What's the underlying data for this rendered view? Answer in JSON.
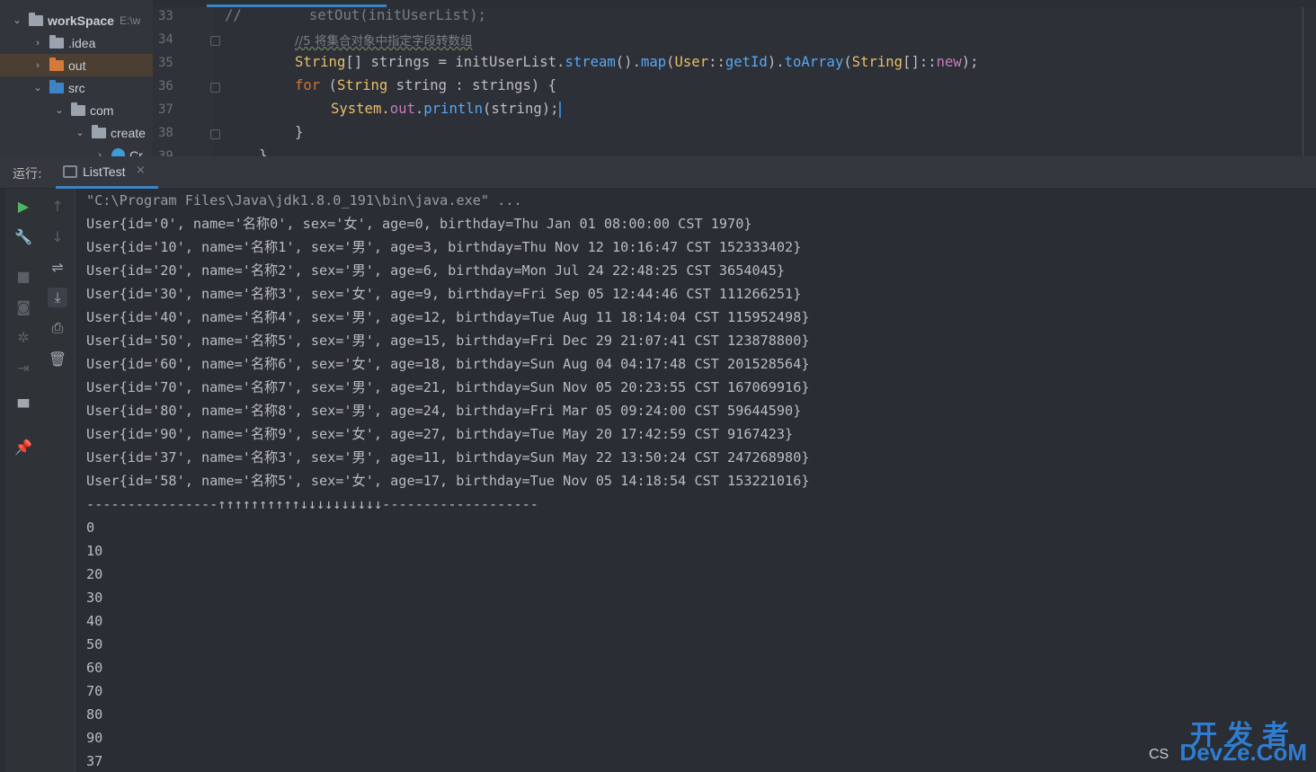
{
  "project_tree": [
    {
      "label": "workSpace",
      "path": "E:\\w",
      "arrow": "v"
    },
    {
      "label": ".idea",
      "arrow": ">"
    },
    {
      "label": "out",
      "arrow": ">"
    },
    {
      "label": "src",
      "arrow": "v"
    },
    {
      "label": "com",
      "arrow": "v"
    },
    {
      "label": "create",
      "arrow": "v"
    },
    {
      "label": "Cr",
      "arrow": ">"
    }
  ],
  "editor": {
    "line_numbers": [
      "33",
      "34",
      "35",
      "36",
      "37",
      "38",
      "39"
    ],
    "line33": {
      "a": "//",
      "b": "setOut(initUserList);"
    },
    "line34": {
      "comment": "//5 将集合对象中指定字段转数组"
    },
    "line35": {
      "t1": "String",
      "t2": "[] strings = initUserList.",
      "m1": "stream",
      "t3": "().",
      "m2": "map",
      "t4": "(",
      "t5": "User",
      "t6": "::",
      "m3": "getId",
      "t7": ").",
      "m4": "toArray",
      "t8": "(",
      "t9": "String",
      "t10": "[]::",
      "kw": "new",
      "t11": ");"
    },
    "line36": {
      "kw": "for",
      "t1": " (",
      "type": "String",
      "t2": " string : strings) {"
    },
    "line37": {
      "t1": "System.",
      "field": "out",
      "t2": ".",
      "method": "println",
      "t3": "(string);"
    },
    "line38": {
      "t1": "}"
    },
    "line39": {
      "t1": "}"
    }
  },
  "run_panel": {
    "label": "运行:",
    "tab_label": "ListTest",
    "tab_close": "×"
  },
  "toolbar_left": [
    {
      "icon": "run-icon",
      "glyph": "▶"
    },
    {
      "icon": "wrench-icon",
      "glyph": "🔧"
    },
    {
      "icon": "stop-icon",
      "glyph": "■"
    },
    {
      "icon": "camera-icon",
      "glyph": "◙"
    },
    {
      "icon": "debug-icon",
      "glyph": "✲"
    },
    {
      "icon": "exit-icon",
      "glyph": "⇥"
    },
    {
      "icon": "layout-icon",
      "glyph": "▀"
    },
    {
      "icon": "pin-icon",
      "glyph": "📌"
    }
  ],
  "toolbar_right": [
    {
      "icon": "up-arrow-icon",
      "glyph": "↑"
    },
    {
      "icon": "down-arrow-icon",
      "glyph": "↓"
    },
    {
      "icon": "soft-wrap-icon",
      "glyph": "⇌"
    },
    {
      "icon": "scroll-to-end-icon",
      "glyph": "⤓"
    },
    {
      "icon": "print-icon",
      "glyph": "⎙"
    },
    {
      "icon": "trash-icon",
      "glyph": "🗑"
    }
  ],
  "console_lines": [
    "\"C:\\Program Files\\Java\\jdk1.8.0_191\\bin\\java.exe\" ...",
    "User{id='0', name='名称0', sex='女', age=0, birthday=Thu Jan 01 08:00:00 CST 1970}",
    "User{id='10', name='名称1', sex='男', age=3, birthday=Thu Nov 12 10:16:47 CST 152333402}",
    "User{id='20', name='名称2', sex='男', age=6, birthday=Mon Jul 24 22:48:25 CST 3654045}",
    "User{id='30', name='名称3', sex='女', age=9, birthday=Fri Sep 05 12:44:46 CST 111266251}",
    "User{id='40', name='名称4', sex='男', age=12, birthday=Tue Aug 11 18:14:04 CST 115952498}",
    "User{id='50', name='名称5', sex='男', age=15, birthday=Fri Dec 29 21:07:41 CST 123878800}",
    "User{id='60', name='名称6', sex='女', age=18, birthday=Sun Aug 04 04:17:48 CST 201528564}",
    "User{id='70', name='名称7', sex='男', age=21, birthday=Sun Nov 05 20:23:55 CST 167069916}",
    "User{id='80', name='名称8', sex='男', age=24, birthday=Fri Mar 05 09:24:00 CST 59644590}",
    "User{id='90', name='名称9', sex='女', age=27, birthday=Tue May 20 17:42:59 CST 9167423}",
    "User{id='37', name='名称3', sex='男', age=11, birthday=Sun May 22 13:50:24 CST 247268980}",
    "User{id='58', name='名称5', sex='女', age=17, birthday=Tue Nov 05 14:18:54 CST 153221016}",
    "----------------↑↑↑↑↑↑↑↑↑↑↓↓↓↓↓↓↓↓↓↓-------------------",
    "0",
    "10",
    "20",
    "30",
    "40",
    "50",
    "60",
    "70",
    "80",
    "90",
    "37"
  ],
  "watermark": {
    "top": "开发者",
    "bottom": "DevZe.CoM",
    "prefix": "CS"
  }
}
